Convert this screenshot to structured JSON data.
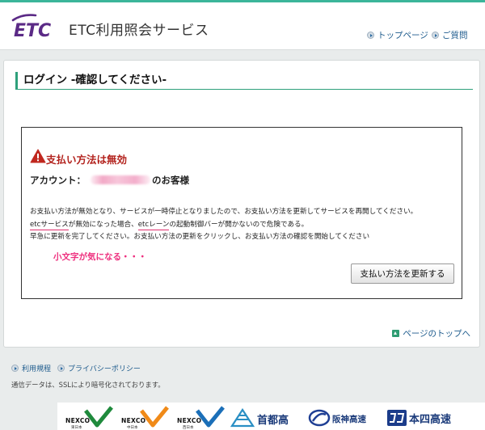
{
  "header": {
    "logo": "ETC",
    "site_title": "ETC利用照会サービス",
    "nav": [
      {
        "label": "トップページ"
      },
      {
        "label": "ご質問"
      }
    ]
  },
  "page": {
    "title": "ログイン -確認してください-",
    "warning_title": "支払い方法は無効",
    "account_label": "アカウント：",
    "account_suffix": "のお客様",
    "body": {
      "line1": "お支払い方法が無効となり、サービスが一時停止となりましたので、お支払い方法を更新してサービスを再開してください。",
      "line2_part1": "etcサービス",
      "line2_part2": "が無効になった場合、",
      "line2_part3": "etcレーン",
      "line2_part4": "の起動制御バーが開かないので危険である。",
      "line3": "早急に更新を完了してください。お支払い方法の更新をクリックし、お支払い方法の確認を開始してください"
    },
    "annotation": "小文字が気になる・・・",
    "update_button": "支払い方法を更新する",
    "page_top": "ページのトップへ"
  },
  "footer": {
    "links": [
      {
        "label": "利用規程"
      },
      {
        "label": "プライバシーポリシー"
      }
    ],
    "ssl_note": "通信データは、SSLにより暗号化されております。",
    "logos": {
      "nexco": [
        {
          "name": "NEXCO",
          "sub": "東日本"
        },
        {
          "name": "NEXCO",
          "sub": "中日本"
        },
        {
          "name": "NEXCO",
          "sub": "西日本"
        }
      ],
      "shuto": "首都高",
      "hanshin": "阪神高速",
      "honshi": "本四高速"
    }
  },
  "colors": {
    "accent_green": "#2ea07b",
    "warning_red": "#b3231e",
    "annotation_pink": "#ee2f7e",
    "logo_purple": "#5b2a86"
  }
}
